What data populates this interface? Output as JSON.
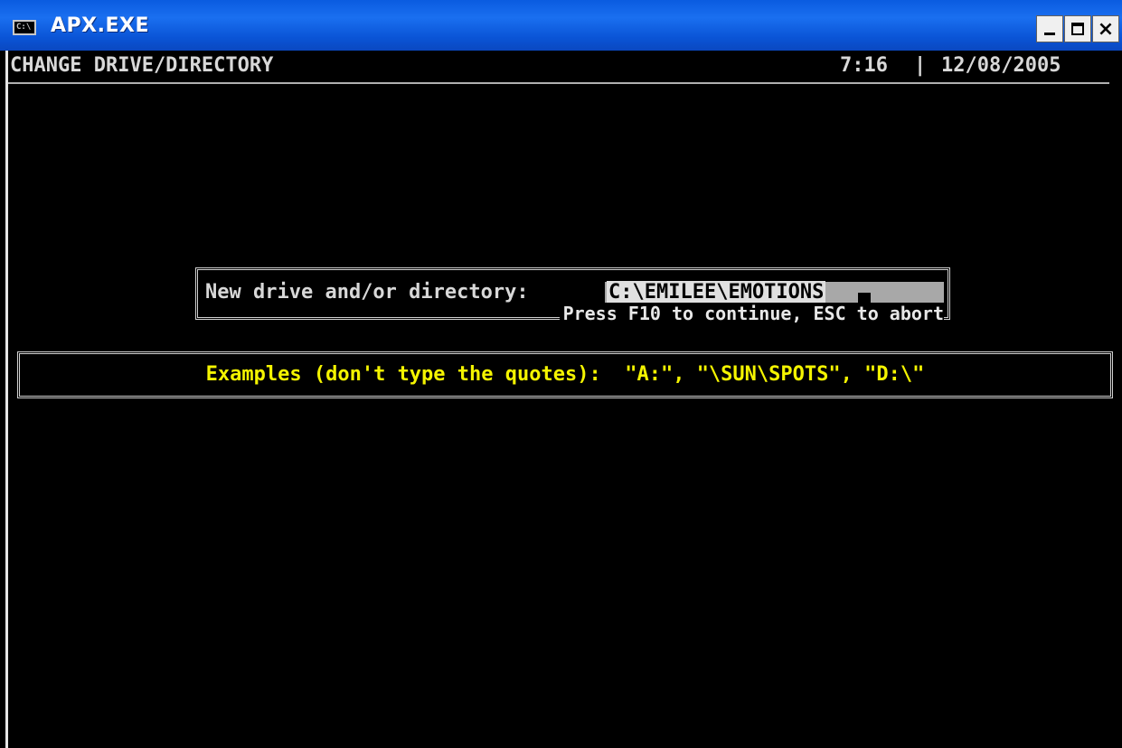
{
  "window": {
    "title": "APX.EXE",
    "icon_label": "C:\\"
  },
  "header": {
    "screen_title": "CHANGE DRIVE/DIRECTORY",
    "time": "7:16",
    "separator": "|",
    "date": "12/08/2005"
  },
  "dialog": {
    "label": "New drive and/or directory:",
    "value": "C:\\EMILEE\\EMOTIONS",
    "hint": "Press F10 to continue, ESC to abort"
  },
  "examples": {
    "text": "Examples (don't type the quotes):  \"A:\", \"\\SUN\\SPOTS\", \"D:\\\""
  },
  "colors": {
    "console_background": "#000000",
    "console_text": "#d8d8d8",
    "examples_text": "#f4f400",
    "titlebar": "#0a5be0"
  }
}
